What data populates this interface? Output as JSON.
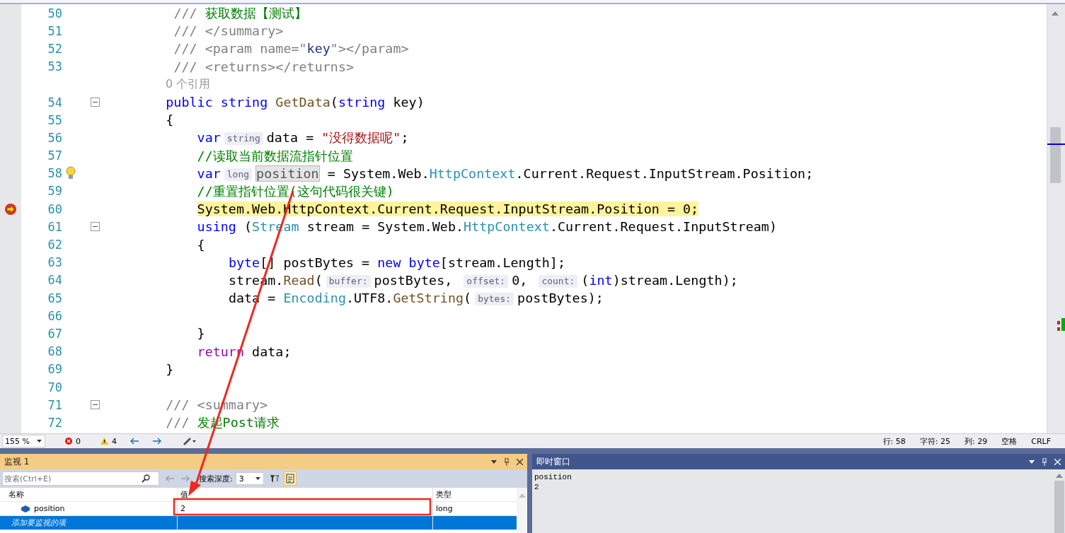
{
  "editor": {
    "lines": [
      {
        "kind": "code",
        "number": "50",
        "current": false,
        "fold": false,
        "tokens": [
          {
            "kind": "doc",
            "text": "     ///"
          },
          {
            "kind": "cmt",
            "text": " 获取数据【测试】"
          }
        ]
      },
      {
        "kind": "code",
        "number": "51",
        "current": false,
        "fold": false,
        "tokens": [
          {
            "kind": "doc",
            "text": "     /// </summary>"
          }
        ]
      },
      {
        "kind": "code",
        "number": "52",
        "current": false,
        "fold": false,
        "tokens": [
          {
            "kind": "doc",
            "text": "     /// <param name=\""
          },
          {
            "kind": "docname",
            "text": "key"
          },
          {
            "kind": "doc",
            "text": "\"></param>"
          }
        ]
      },
      {
        "kind": "code",
        "number": "53",
        "current": false,
        "fold": false,
        "tokens": [
          {
            "kind": "doc",
            "text": "     /// <returns></returns>"
          }
        ]
      },
      {
        "kind": "codelens",
        "text": "0 个引用"
      },
      {
        "kind": "code",
        "number": "54",
        "current": false,
        "fold": true,
        "tokens": [
          {
            "kind": "kw",
            "text": "    public"
          },
          {
            "kind": "kw",
            "text": " string"
          },
          {
            "kind": "method",
            "text": " GetData"
          },
          {
            "kind": "plain",
            "text": "("
          },
          {
            "kind": "kw",
            "text": "string"
          },
          {
            "kind": "plain",
            "text": " key)"
          }
        ]
      },
      {
        "kind": "code",
        "number": "55",
        "current": false,
        "fold": false,
        "tokens": [
          {
            "kind": "plain",
            "text": "    {"
          }
        ]
      },
      {
        "kind": "code",
        "number": "56",
        "current": false,
        "fold": false,
        "tokens": [
          {
            "kind": "kw",
            "text": "        var"
          },
          {
            "kind": "hint",
            "text": "string"
          },
          {
            "kind": "plain",
            "text": "data = "
          },
          {
            "kind": "str",
            "text": "\"没得数据呢\""
          },
          {
            "kind": "plain",
            "text": ";"
          }
        ]
      },
      {
        "kind": "code",
        "number": "57",
        "current": false,
        "fold": false,
        "tokens": [
          {
            "kind": "cmt",
            "text": "        //读取当前数据流指针位置"
          }
        ]
      },
      {
        "kind": "code",
        "number": "58",
        "current": false,
        "fold": false,
        "bulb": true,
        "tokens": [
          {
            "kind": "kw",
            "text": "        var"
          },
          {
            "kind": "hint",
            "text": "long"
          },
          {
            "kind": "ref",
            "text": "position"
          },
          {
            "kind": "plain",
            "text": " = System.Web."
          },
          {
            "kind": "type",
            "text": "HttpContext"
          },
          {
            "kind": "plain",
            "text": ".Current.Request.InputStream.Position;"
          }
        ]
      },
      {
        "kind": "code",
        "number": "59",
        "current": false,
        "fold": false,
        "tokens": [
          {
            "kind": "cmt",
            "text": "        //重置指针位置(这句代码很关键)"
          }
        ]
      },
      {
        "kind": "code",
        "number": "60",
        "current": true,
        "fold": false,
        "tokens": [
          {
            "kind": "plain",
            "text": "        System.Web.HttpContext.Current.Request.InputStream.Position = 0;"
          }
        ]
      },
      {
        "kind": "code",
        "number": "61",
        "current": false,
        "fold": true,
        "tokens": [
          {
            "kind": "kw",
            "text": "        using"
          },
          {
            "kind": "plain",
            "text": " ("
          },
          {
            "kind": "type",
            "text": "Stream"
          },
          {
            "kind": "plain",
            "text": " stream = System.Web."
          },
          {
            "kind": "type",
            "text": "HttpContext"
          },
          {
            "kind": "plain",
            "text": ".Current.Request.InputStream)"
          }
        ]
      },
      {
        "kind": "code",
        "number": "62",
        "current": false,
        "fold": false,
        "tokens": [
          {
            "kind": "plain",
            "text": "        {"
          }
        ]
      },
      {
        "kind": "code",
        "number": "63",
        "current": false,
        "fold": false,
        "tokens": [
          {
            "kind": "kw",
            "text": "            byte"
          },
          {
            "kind": "plain",
            "text": "[] postBytes = "
          },
          {
            "kind": "kw",
            "text": "new"
          },
          {
            "kind": "kw",
            "text": " byte"
          },
          {
            "kind": "plain",
            "text": "[stream.Length];"
          }
        ]
      },
      {
        "kind": "code",
        "number": "64",
        "current": false,
        "fold": false,
        "tokens": [
          {
            "kind": "plain",
            "text": "            stream."
          },
          {
            "kind": "method",
            "text": "Read"
          },
          {
            "kind": "plain",
            "text": "("
          },
          {
            "kind": "hint",
            "text": "buffer:"
          },
          {
            "kind": "plain",
            "text": "postBytes, "
          },
          {
            "kind": "hint",
            "text": "offset:"
          },
          {
            "kind": "plain",
            "text": "0, "
          },
          {
            "kind": "hint",
            "text": "count:"
          },
          {
            "kind": "plain",
            "text": "("
          },
          {
            "kind": "kw",
            "text": "int"
          },
          {
            "kind": "plain",
            "text": ")stream.Length);"
          }
        ]
      },
      {
        "kind": "code",
        "number": "65",
        "current": false,
        "fold": false,
        "tokens": [
          {
            "kind": "plain",
            "text": "            data = "
          },
          {
            "kind": "type",
            "text": "Encoding"
          },
          {
            "kind": "plain",
            "text": ".UTF8."
          },
          {
            "kind": "method",
            "text": "GetString"
          },
          {
            "kind": "plain",
            "text": "("
          },
          {
            "kind": "hint",
            "text": "bytes:"
          },
          {
            "kind": "plain",
            "text": "postBytes);"
          }
        ]
      },
      {
        "kind": "code",
        "number": "66",
        "current": false,
        "fold": false
      },
      {
        "kind": "code",
        "number": "67",
        "current": false,
        "fold": false,
        "tokens": [
          {
            "kind": "plain",
            "text": "        }"
          }
        ]
      },
      {
        "kind": "code",
        "number": "68",
        "current": false,
        "fold": false,
        "tokens": [
          {
            "kind": "ctrl",
            "text": "        return"
          },
          {
            "kind": "plain",
            "text": " data;"
          }
        ]
      },
      {
        "kind": "code",
        "number": "69",
        "current": false,
        "fold": false,
        "tokens": [
          {
            "kind": "plain",
            "text": "    }"
          }
        ]
      },
      {
        "kind": "code",
        "number": "70",
        "current": false,
        "fold": false
      },
      {
        "kind": "code",
        "number": "71",
        "current": false,
        "fold": true,
        "tokens": [
          {
            "kind": "doc",
            "text": "    /// <summary>"
          }
        ]
      },
      {
        "kind": "code",
        "number": "72",
        "current": false,
        "fold": false,
        "tokens": [
          {
            "kind": "doc",
            "text": "    ///"
          },
          {
            "kind": "cmt",
            "text": " 发起Post请求"
          }
        ]
      }
    ]
  },
  "status_bar": {
    "zoom": "155 %",
    "errors": "0",
    "warnings": "4",
    "line": "行: 58",
    "char": "字符: 25",
    "col": "列: 29",
    "spaces": "空格",
    "eol": "CRLF"
  },
  "watch": {
    "title": "监视 1",
    "search": {
      "placeholder": "搜索(Ctrl+E)"
    },
    "depth_label": "搜索深度:",
    "depth": "3",
    "columns": [
      "名称",
      "值",
      "类型"
    ],
    "rows": [
      {
        "name": "position",
        "value": "2",
        "type": "long",
        "selected": false
      }
    ],
    "add_row": {
      "text": "添加要监视的项",
      "selected": true
    }
  },
  "immediate": {
    "title": "即时窗口",
    "lines": [
      "position",
      "2"
    ]
  }
}
